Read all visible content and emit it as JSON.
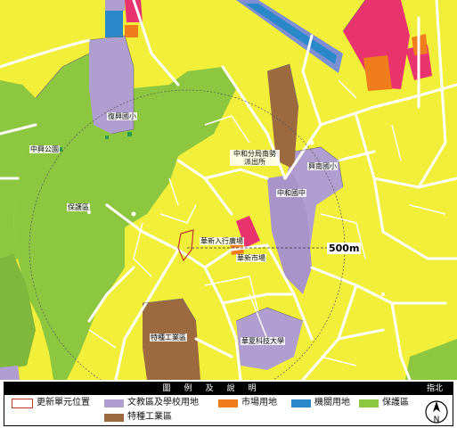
{
  "map": {
    "labels": {
      "zhongxing_park": "中興公園",
      "protection_area": "保護區",
      "fuxing_elementary": "復興國小",
      "zhonghe_police": "中和分局南勢派出所",
      "xingnan_elementary": "興南國小",
      "zhonghe_junior_high": "中和國中",
      "huaxin_square": "華新入行廣場",
      "huaxin_market": "華新市場",
      "special_industrial": "特種工業區",
      "huaxia_university": "華夏科技大學"
    },
    "scale_label": "500m"
  },
  "legend": {
    "header": "圖　例　及　說　明",
    "north_label": "指北",
    "north_letter": "N",
    "items": [
      {
        "label": "更新單元位置",
        "color": "#ffffff",
        "border": "#c0392b"
      },
      {
        "label": "文教區及學校用地",
        "color": "#b09ed0"
      },
      {
        "label": "市場用地",
        "color": "#f07d1c"
      },
      {
        "label": "機關用地",
        "color": "#2a88c9"
      },
      {
        "label": "保護區",
        "color": "#8dc63f"
      },
      {
        "label": "特種工業區",
        "color": "#9c6a3e"
      }
    ]
  },
  "colors": {
    "residential": "#f2ef3a",
    "protection": "#8dc63f",
    "school": "#b09ed0",
    "market": "#f07d1c",
    "government": "#2a88c9",
    "industrial": "#9c6a3e",
    "commercial": "#e8336e",
    "highway": "#7c8fd4"
  }
}
